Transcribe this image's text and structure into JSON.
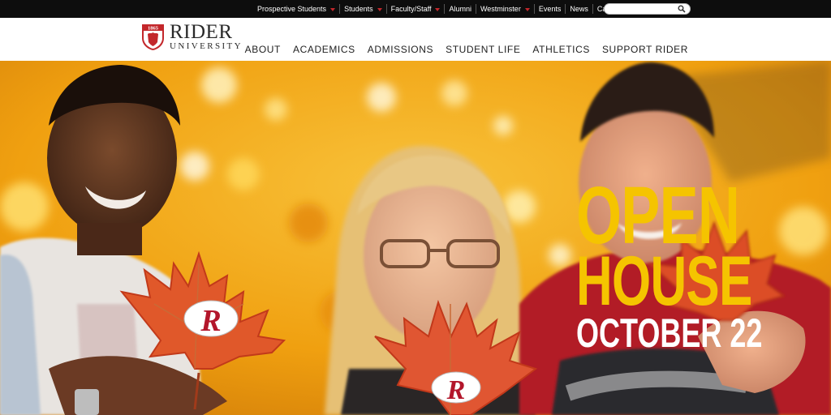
{
  "utility": {
    "items": [
      {
        "label": "Prospective Students",
        "dropdown": true
      },
      {
        "label": "Students",
        "dropdown": true
      },
      {
        "label": "Faculty/Staff",
        "dropdown": true
      },
      {
        "label": "Alumni",
        "dropdown": false
      },
      {
        "label": "Westminster",
        "dropdown": true
      },
      {
        "label": "Events",
        "dropdown": false
      },
      {
        "label": "News",
        "dropdown": false
      },
      {
        "label": "Campus Updates",
        "dropdown": false
      }
    ],
    "search_placeholder": "",
    "search_icon": "search-icon"
  },
  "header": {
    "logo_year": "1865",
    "logo_name": "RIDER",
    "logo_sub": "UNIVERSITY",
    "nav": [
      "ABOUT",
      "ACADEMICS",
      "ADMISSIONS",
      "STUDENT LIFE",
      "ATHLETICS",
      "SUPPORT RIDER"
    ]
  },
  "hero": {
    "line1": "OPEN",
    "line2": "HOUSE",
    "line3": "OCTOBER 22"
  },
  "colors": {
    "brand_red": "#c3272b",
    "promo_yellow": "#f5c400",
    "utility_bg": "#0d0d0d"
  }
}
